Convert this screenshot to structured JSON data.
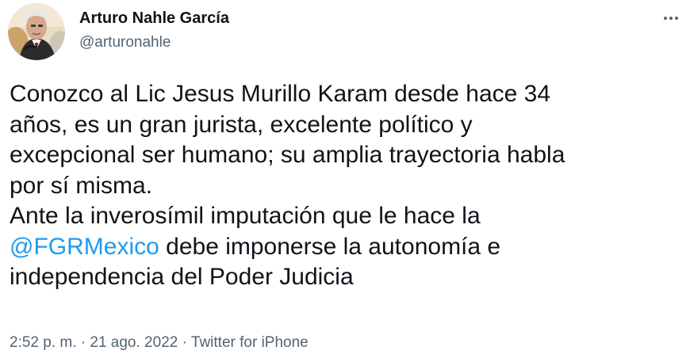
{
  "author": {
    "name": "Arturo Nahle García",
    "handle": "@arturonahle"
  },
  "more_icon": "more-horizontal-icon",
  "tweet": {
    "lines": [
      "Conozco al Lic Jesus Murillo Karam desde hace 34",
      "años, es un gran jurista, excelente político y",
      "excepcional ser humano; su amplia trayectoria habla",
      "por sí misma.",
      "Ante la inverosímil imputación que le hace la"
    ],
    "mention": "@FGRMexico",
    "line6_rest": " debe imponerse la autonomía e",
    "line7": "independencia del Poder Judicia"
  },
  "meta": {
    "time": "2:52 p. m.",
    "sep1": " · ",
    "date": "21 ago. 2022",
    "sep2": " · ",
    "source": "Twitter for iPhone"
  },
  "colors": {
    "text": "#0f1419",
    "secondary": "#536471",
    "link": "#1d9bf0"
  }
}
